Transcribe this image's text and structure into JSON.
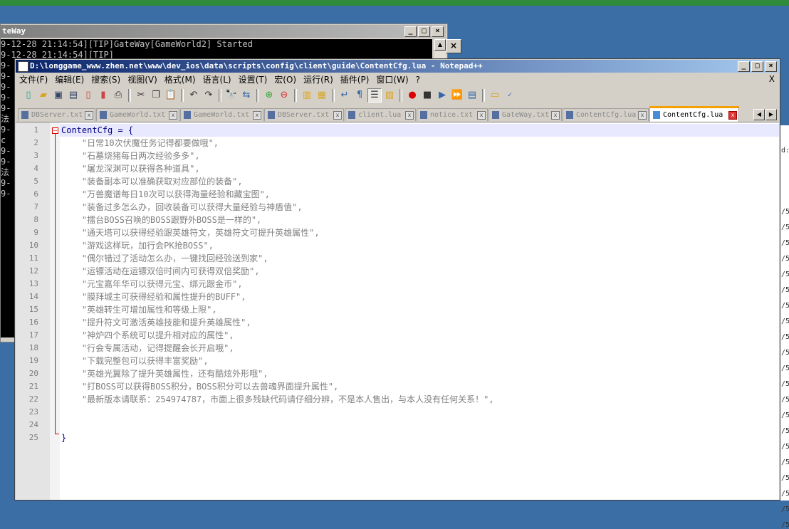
{
  "console": {
    "title": "teWay",
    "lines": [
      "9-12-28 21:14:54][TIP]GateWay[GameWorld2] Started",
      "9-12-28 21:14:54][TIP]",
      "9-",
      "9-",
      "9-",
      "9-",
      "9-",
      "法",
      "9-",
      "c",
      "9-",
      "9-",
      "法",
      "9-",
      "9-"
    ]
  },
  "notepad": {
    "title": "D:\\longgame_www.zhen.net\\www\\dev_ios\\data\\scripts\\config\\client\\guide\\ContentCfg.lua - Notepad++",
    "menu": [
      "文件(F)",
      "编辑(E)",
      "搜索(S)",
      "视图(V)",
      "格式(M)",
      "语言(L)",
      "设置(T)",
      "宏(O)",
      "运行(R)",
      "插件(P)",
      "窗口(W)",
      "?"
    ],
    "menu_close": "X",
    "tabs": [
      "DBServer.txt",
      "GameWorld.txt",
      "GameWorld.txt",
      "DBServer.txt",
      "client.lua",
      "notice.txt",
      "GateWay.txt",
      "ContentCfg.lua",
      "ContentCfg.lua"
    ],
    "lines": [
      "ContentCfg = {",
      "    \"日常10次伏魔任务记得都要做哦\",",
      "    \"石墓烧猪每日两次经验多多\",",
      "    \"屠龙深渊可以获得各种道具\",",
      "    \"装备副本可以准确获取对应部位的装备\",",
      "    \"万兽魔谱每日10次可以获得海量经验和藏宝图\",",
      "    \"装备过多怎么办，回收装备可以获得大量经验与神盾值\",",
      "    \"擂台BOSS召唤的BOSS跟野外BOSS是一样的\",",
      "    \"通天塔可以获得经验跟英雄符文，英雄符文可提升英雄属性\",",
      "    \"游戏这样玩，加行会PK抢BOSS\",",
      "    \"偶尔错过了活动怎么办，一键找回经验送到家\",",
      "    \"运镖活动在运镖双倍时间内可获得双倍奖励\",",
      "    \"元宝嘉年华可以获得元宝、绑元跟金币\",",
      "    \"膜拜城主可获得经验和属性提升的BUFF\",",
      "    \"英雄转生可增加属性和等级上限\",",
      "    \"提升符文可激活英雄技能和提升英雄属性\",",
      "    \"神炉四个系统可以提升相对应的属性\",",
      "    \"行会专属活动，记得提醒会长开启哦\",",
      "    \"下载完整包可以获得丰富奖励\",",
      "    \"英雄光翼除了提升英雄属性，还有酷炫外形哦\",",
      "    \"打BOSS可以获得BOSS积分，BOSS积分可以去兽魂界面提升属性\",",
      "    \"最新版本请联系：254974787，市面上很多残缺代码请仔细分辨，不是本人售出，与本人没有任何关系！\",",
      "",
      "",
      "}"
    ]
  },
  "right_window": {
    "labels": [
      "d:",
      "/5",
      "/5",
      "/5",
      "/5",
      "/5",
      "/5",
      "/5",
      "/5",
      "/5",
      "/5",
      "/5",
      "/5",
      "/5",
      "/5",
      "/5",
      "/5",
      "/5",
      "/5",
      "/5",
      "/5",
      "/5"
    ]
  }
}
